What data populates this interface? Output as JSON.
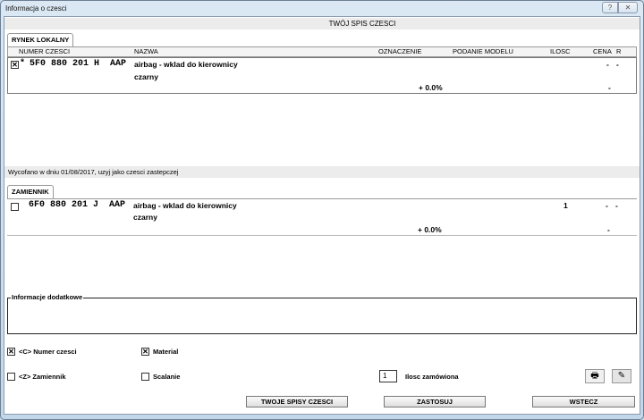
{
  "window": {
    "title": "Informacja o czesci",
    "help_icon": "help-icon",
    "close_icon": "close-icon"
  },
  "header_band": "TWÓJ SPIS CZESCI",
  "columns": [
    "NUMER CZESCI",
    "NAZWA",
    "OZNACZENIE",
    "PODANIE MODELU",
    "ILOSC",
    "CENA",
    "R"
  ],
  "local": {
    "tab": "RYNEK LOKALNY",
    "row": {
      "checked": true,
      "marker": "*",
      "part_number": "5F0 880 201 H",
      "brand": "AAP",
      "name_line1": "airbag - wklad do kierownicy",
      "name_line2": "czarny",
      "percent": "+ 0.0%",
      "price": "-",
      "r": "-",
      "price2": "-"
    }
  },
  "withdrawn_note": "Wycofano w dniu 01/08/2017, uzyj jako czesci zastepczej",
  "replacement": {
    "tab": "ZAMIENNIK",
    "row": {
      "checked": false,
      "part_number": "6F0 880 201 J",
      "brand": "AAP",
      "name_line1": "airbag - wklad do kierownicy",
      "name_line2": "czarny",
      "qty": "1",
      "percent": "+ 0.0%",
      "price": "-",
      "r": "-",
      "price2": "-"
    }
  },
  "additional_info": {
    "label": "Informacje dodatkowe",
    "value": ""
  },
  "options": {
    "part_number": {
      "label": "<C> Numer czesci",
      "checked": true
    },
    "material": {
      "label": "Material",
      "checked": true
    },
    "replacement": {
      "label": "<Z> Zamiennik",
      "checked": false
    },
    "merge": {
      "label": "Scalanie",
      "checked": false
    }
  },
  "order_qty": {
    "value": "1",
    "label": "Ilosc zamówiona"
  },
  "buttons": {
    "lists": "TWOJE SPISY CZESCI",
    "apply": "ZASTOSUJ",
    "back": "WSTECZ"
  }
}
